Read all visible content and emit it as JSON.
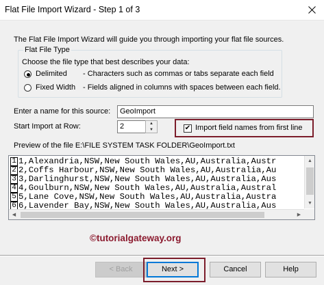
{
  "window": {
    "title": "Flat File Import Wizard - Step 1 of 3",
    "close_glyph": "✕"
  },
  "intro_text": "The Flat File Import Wizard will guide you through importing your flat file sources.",
  "file_type_group": {
    "title": "Flat File Type",
    "prompt": "Choose the file type that best describes your data:",
    "options": [
      {
        "label": "Delimited",
        "description": "- Characters such as commas or tabs separate each field",
        "selected": true
      },
      {
        "label": "Fixed Width",
        "description": "- Fields aligned in columns with spaces between each field.",
        "selected": false
      }
    ]
  },
  "source_name": {
    "label": "Enter a name for this source:",
    "value": "GeoImport"
  },
  "start_row": {
    "label": "Start Import at Row:",
    "value": "2"
  },
  "field_names_checkbox": {
    "label": "Import field names from first line",
    "checked": true,
    "check_glyph": "✔"
  },
  "preview": {
    "label": "Preview of the file E:\\FILE SYSTEM TASK FOLDER\\GeoImport.txt",
    "rows": [
      {
        "num": "1",
        "text": "1,Alexandria,NSW,New South Wales,AU,Australia,Austr"
      },
      {
        "num": "2",
        "text": "2,Coffs Harbour,NSW,New South Wales,AU,Australia,Au"
      },
      {
        "num": "3",
        "text": "3,Darlinghurst,NSW,New South Wales,AU,Australia,Aus"
      },
      {
        "num": "4",
        "text": "4,Goulburn,NSW,New South Wales,AU,Australia,Austral"
      },
      {
        "num": "5",
        "text": "5,Lane Cove,NSW,New South Wales,AU,Australia,Austra"
      },
      {
        "num": "6",
        "text": "6,Lavender Bay,NSW,New South Wales,AU,Australia,Aus"
      }
    ]
  },
  "watermark": "©tutorialgateway.org",
  "buttons": {
    "back": "< Back",
    "next": "Next >",
    "cancel": "Cancel",
    "help": "Help"
  },
  "colors": {
    "highlight": "#7b1c2a",
    "watermark": "#8b1a2e",
    "dialog_bg": "#f0f0f0"
  }
}
